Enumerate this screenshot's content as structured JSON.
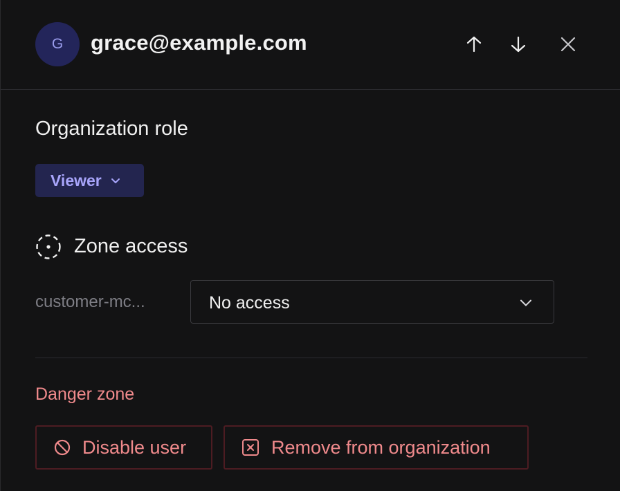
{
  "header": {
    "avatar_initial": "G",
    "email": "grace@example.com",
    "icons": [
      "arrow-up-icon",
      "arrow-down-icon",
      "close-icon"
    ]
  },
  "organization_role": {
    "title": "Organization role",
    "selected_role": "Viewer"
  },
  "zone_access": {
    "title": "Zone access",
    "zones": [
      {
        "name": "customer-mc...",
        "access": "No access"
      }
    ]
  },
  "danger_zone": {
    "title": "Danger zone",
    "disable_label": "Disable user",
    "remove_label": "Remove from organization"
  },
  "colors": {
    "background": "#131314",
    "avatar_bg": "#23255a",
    "role_bg": "#23254f",
    "role_text": "#a8a5fb",
    "danger_text": "#f08a8c",
    "danger_border": "#4d1c22"
  }
}
